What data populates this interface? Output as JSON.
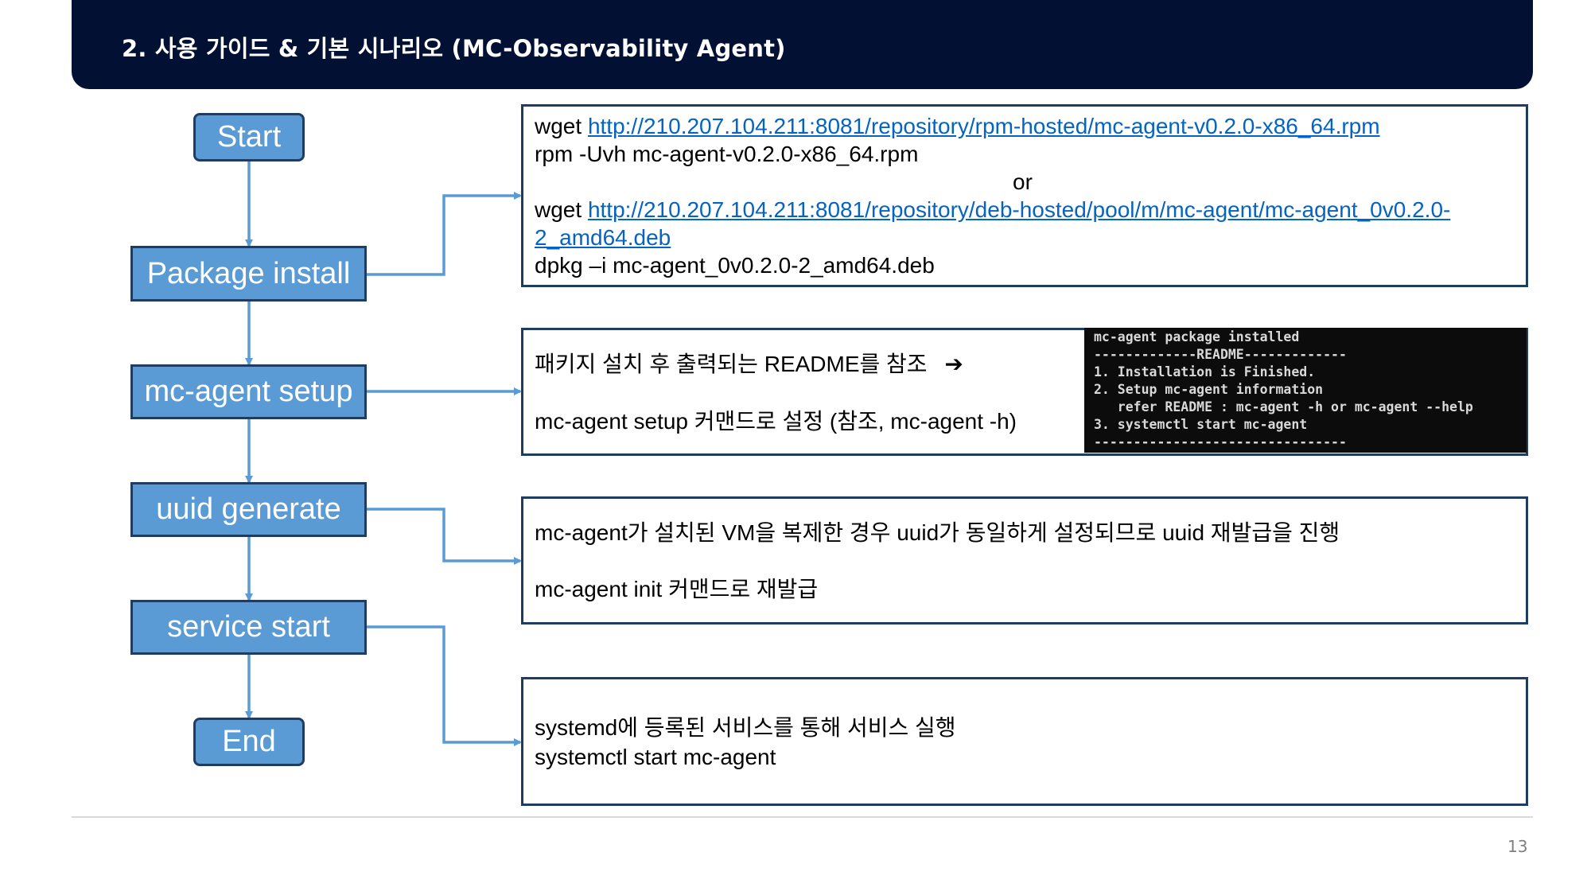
{
  "header": {
    "title": "2. 사용 가이드 & 기본 시나리오 (MC-Observability Agent)"
  },
  "flow": {
    "start": "Start",
    "package_install": "Package install",
    "agent_setup": "mc-agent setup",
    "uuid_generate": "uuid generate",
    "service_start": "service start",
    "end": "End"
  },
  "install_box": {
    "wget_prefix_1": "wget ",
    "rpm_url": "http://210.207.104.211:8081/repository/rpm-hosted/mc-agent-v0.2.0-x86_64.rpm",
    "rpm_cmd": "rpm -Uvh mc-agent-v0.2.0-x86_64.rpm",
    "or": "or",
    "wget_prefix_2": "wget ",
    "deb_url_line1": "http://210.207.104.211:8081/repository/deb-hosted/pool/m/mc-agent/mc-agent_0v0.2.0-",
    "deb_url_line2": "2_amd64.deb",
    "dpkg_cmd": "dpkg –i mc-agent_0v0.2.0-2_amd64.deb"
  },
  "setup_box": {
    "line1": "패키지 설치 후 출력되는 README를 참조",
    "arrow_glyph": "➔",
    "line2": "mc-agent setup 커맨드로 설정 (참조, mc-agent -h)"
  },
  "terminal": {
    "lines": [
      "mc-agent package installed",
      "-------------README-------------",
      "1. Installation is Finished.",
      "2. Setup mc-agent information",
      "   refer README : mc-agent -h or mc-agent --help",
      "3. systemctl start mc-agent",
      "--------------------------------"
    ]
  },
  "uuid_box": {
    "line1": "mc-agent가 설치된 VM을 복제한 경우 uuid가 동일하게 설정되므로 uuid 재발급을 진행",
    "line2": "mc-agent init 커맨드로 재발급"
  },
  "service_box": {
    "line1": "systemd에 등록된 서비스를 통해 서비스 실행",
    "line2": "systemctl start mc-agent"
  },
  "page_number": "13",
  "colors": {
    "header_bg": "#021133",
    "node_fill": "#5b9bd5",
    "node_border": "#1f3d63",
    "connector": "#5b9bd5",
    "link": "#0563c1"
  }
}
